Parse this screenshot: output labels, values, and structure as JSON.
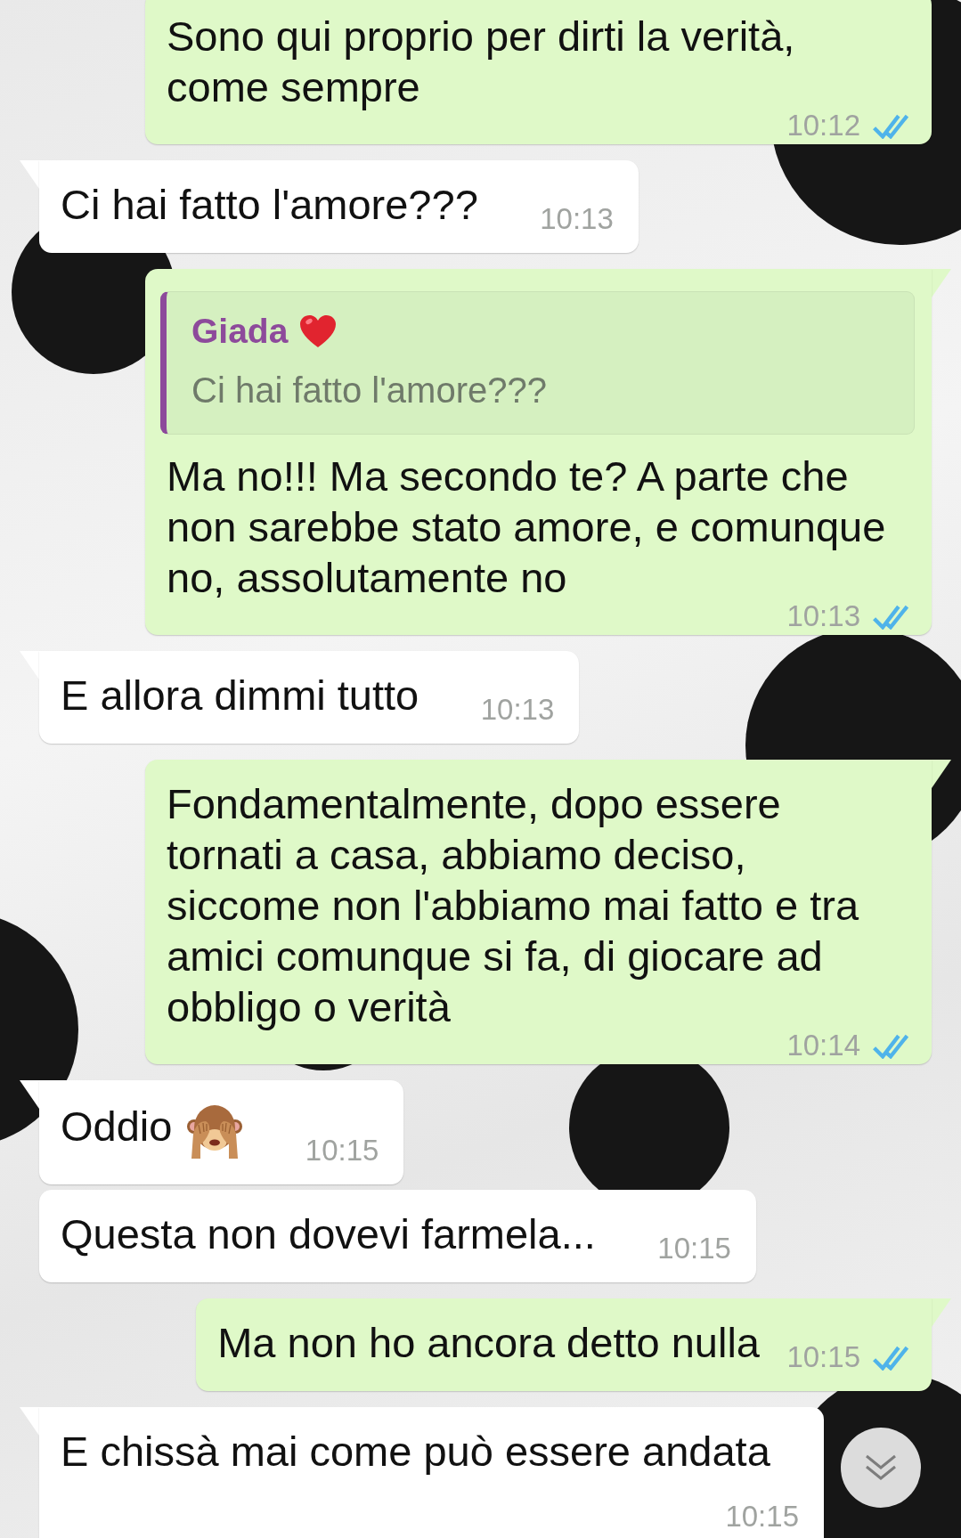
{
  "messages": [
    {
      "kind": "outgoing",
      "text": "Sono qui proprio per dirti la verità, come sempre",
      "time": "10:12",
      "read": true
    },
    {
      "kind": "incoming",
      "text": "Ci hai fatto l'amore???",
      "time": "10:13"
    },
    {
      "kind": "outgoing",
      "quote": {
        "author": "Giada",
        "author_heart": true,
        "text": "Ci hai fatto l'amore???"
      },
      "text": "Ma no!!! Ma secondo te? A parte che non sarebbe stato amore, e comunque no, assolutamente no",
      "time": "10:13",
      "read": true
    },
    {
      "kind": "incoming",
      "text": "E allora dimmi tutto",
      "time": "10:13"
    },
    {
      "kind": "outgoing",
      "text": "Fondamentalmente, dopo essere tornati a casa, abbiamo deciso, siccome non l'abbiamo mai fatto e tra amici comunque si fa, di giocare ad obbligo o verità",
      "time": "10:14",
      "read": true
    },
    {
      "kind": "incoming",
      "text": "Oddio",
      "trailing_emoji": true,
      "time": "10:15"
    },
    {
      "kind": "incoming",
      "text": "Questa non dovevi farmela...",
      "time": "10:15"
    },
    {
      "kind": "outgoing",
      "text": "Ma non ho ancora detto nulla",
      "time": "10:15",
      "read": true
    },
    {
      "kind": "incoming",
      "text": "E chissà mai come può essere andata",
      "time": "10:15"
    }
  ]
}
